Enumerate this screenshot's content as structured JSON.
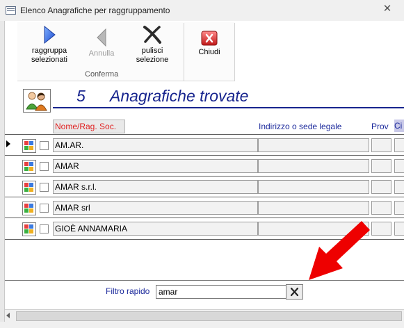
{
  "window": {
    "title": "Elenco Anagrafiche per raggruppamento",
    "close_glyph": "✕"
  },
  "ribbon": {
    "raggruppa": {
      "line1": "raggruppa",
      "line2": "selezionati",
      "icon": "play-arrow-icon"
    },
    "annulla": {
      "label": "Annulla",
      "icon": "back-arrow-icon"
    },
    "pulisci": {
      "line1": "pulisci",
      "line2": "selezione",
      "icon": "x-mark-icon"
    },
    "chiudi": {
      "label": "Chiudi",
      "icon": "close-red-icon"
    },
    "group_label": "Conferma"
  },
  "header": {
    "count": "5",
    "found_label": "Anagrafiche trovate",
    "icon": "people-icon"
  },
  "columns": {
    "nome": "Nome/Rag. Soc.",
    "indirizzo": "Indirizzo o sede legale",
    "prov": "Prov",
    "ci": "Ci"
  },
  "rows": [
    {
      "name": "AM.AR."
    },
    {
      "name": "AMAR"
    },
    {
      "name": "AMAR s.r.l."
    },
    {
      "name": "AMAR srl"
    },
    {
      "name": "GIOÈ ANNAMARIA"
    }
  ],
  "filter": {
    "label": "Filtro rapido",
    "value": "amar",
    "clear_icon": "clear-x-icon"
  },
  "colors": {
    "accent_blue": "#17248e",
    "header_red": "#e02020",
    "arrow_red": "#ee0000"
  }
}
